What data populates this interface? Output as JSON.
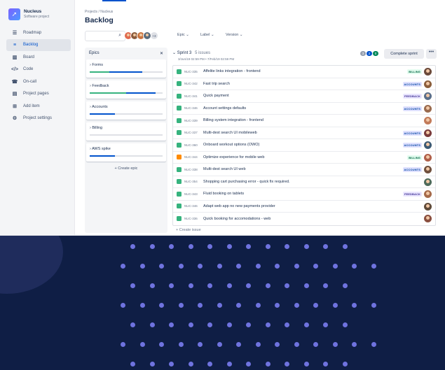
{
  "project": {
    "name": "Nucleus",
    "subtitle": "Software project"
  },
  "sidebar": {
    "items": [
      {
        "label": "Roadmap",
        "icon": "roadmap-icon",
        "glyph": "☰",
        "active": false
      },
      {
        "label": "Backlog",
        "icon": "backlog-icon",
        "glyph": "≡",
        "active": true
      },
      {
        "label": "Board",
        "icon": "board-icon",
        "glyph": "▥",
        "active": false
      },
      {
        "label": "Code",
        "icon": "code-icon",
        "glyph": "</>",
        "active": false
      },
      {
        "label": "On-call",
        "icon": "on-call-icon",
        "glyph": "☎",
        "active": false
      },
      {
        "label": "Project pages",
        "icon": "pages-icon",
        "glyph": "▤",
        "active": false
      },
      {
        "label": "Add item",
        "icon": "add-item-icon",
        "glyph": "⊞",
        "active": false
      },
      {
        "label": "Project settings",
        "icon": "settings-icon",
        "glyph": "⚙",
        "active": false
      }
    ]
  },
  "header": {
    "breadcrumb": "Projects / Nucleus",
    "title": "Backlog",
    "search_placeholder": "",
    "more_avatars": "+3",
    "filters": [
      "Epic",
      "Label",
      "Version"
    ]
  },
  "epics": {
    "title": "Epics",
    "items": [
      {
        "name": "Forms",
        "progress": {
          "done": 0.27,
          "in_progress": 0.45
        }
      },
      {
        "name": "Feedback",
        "progress": {
          "done": 0.5,
          "in_progress": 0.4
        }
      },
      {
        "name": "Accounts",
        "progress": {
          "done": 0.0,
          "in_progress": 0.35
        }
      },
      {
        "name": "Billing",
        "progress": {
          "done": 0.0,
          "in_progress": 0.0
        }
      },
      {
        "name": "AWS spike",
        "progress": {
          "done": 0.0,
          "in_progress": 0.35
        }
      }
    ],
    "create_label": "Create epic"
  },
  "sprint": {
    "name": "Sprint 3",
    "count": "5 issues",
    "dates": "3/Jun/19 02:59 PM • 7/Feb/19 02:59 PM",
    "pills": [
      {
        "value": "3",
        "color": "#97a0af"
      },
      {
        "value": "2",
        "color": "#0052cc"
      },
      {
        "value": "0",
        "color": "#00875a"
      }
    ],
    "complete_label": "Complete sprint",
    "more_label": "•••",
    "create_issue_label": "Create issue"
  },
  "issues": [
    {
      "key": "NUC-335",
      "summary": "Affelite links integration - frontend",
      "label": "BILLING",
      "type": "story"
    },
    {
      "key": "NUC-342",
      "summary": "Fast trip search",
      "label": "ACCOUNTS",
      "type": "story"
    },
    {
      "key": "NUC-341",
      "summary": "Quick payment",
      "label": "FEEDBACK",
      "type": "story"
    },
    {
      "key": "NUC-346",
      "summary": "Account settings defaults",
      "label": "ACCOUNTS",
      "type": "story"
    },
    {
      "key": "NUC-339",
      "summary": "Billing system integration - frontend",
      "label": "",
      "type": "story"
    },
    {
      "key": "NUC-337",
      "summary": "Multi-dest search UI mobileweb",
      "label": "ACCOUNTS",
      "type": "story"
    },
    {
      "key": "NUC-360",
      "summary": "Onboard workout options (OWO)",
      "label": "ACCOUNTS",
      "type": "story"
    },
    {
      "key": "NUC-344",
      "summary": "Optimize experience for mobile web",
      "label": "BILLING",
      "type": "bug"
    },
    {
      "key": "NUC-338",
      "summary": "Multi-dest search UI web",
      "label": "ACCOUNTS",
      "type": "story"
    },
    {
      "key": "NUC-354",
      "summary": "Shopping cart purchasing error - quick fix required.",
      "label": "",
      "type": "story"
    },
    {
      "key": "NUC-343",
      "summary": "Fluid booking on tablets",
      "label": "FEEDBACK",
      "type": "story"
    },
    {
      "key": "NUC-346",
      "summary": "Adapt web app no new payments provider",
      "label": "",
      "type": "story"
    },
    {
      "key": "NUC-336",
      "summary": "Quick booking for accomodations - web",
      "label": "",
      "type": "story"
    }
  ],
  "colors": {
    "background": "#0f1e45",
    "dots": "#6f73df",
    "accent": "#0052cc",
    "success": "#36b37e"
  }
}
